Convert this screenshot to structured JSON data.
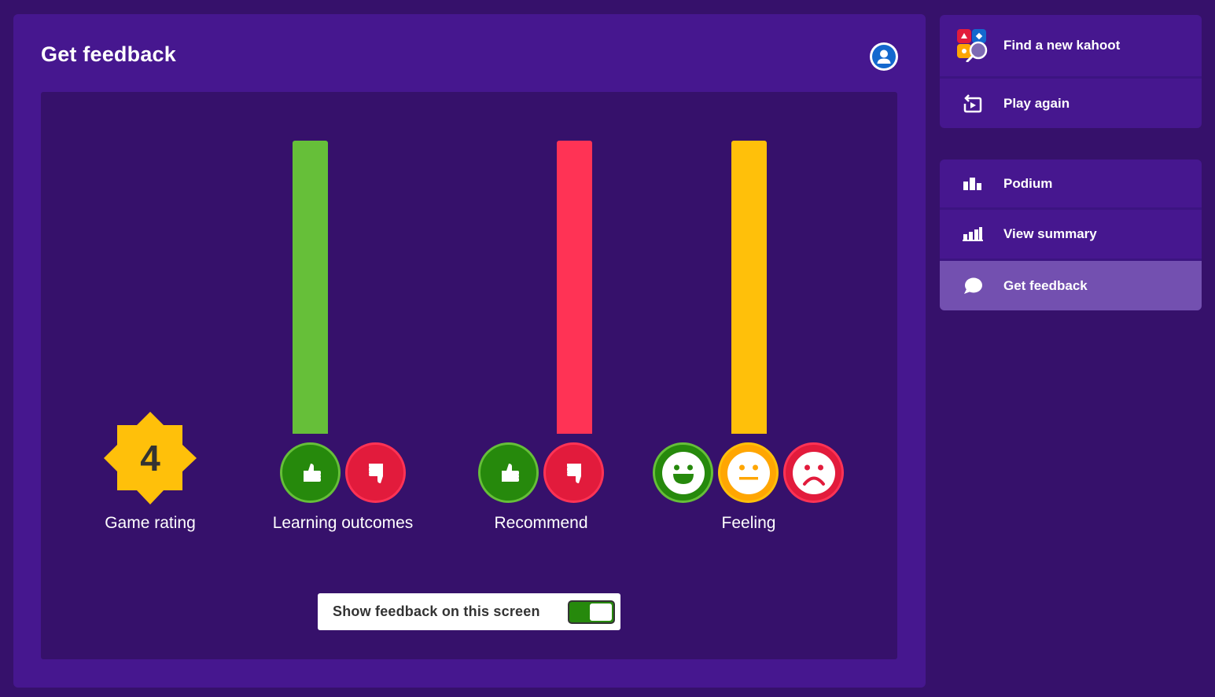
{
  "main": {
    "title": "Get feedback",
    "account_icon": "user-account-icon",
    "rating": {
      "value": "4",
      "label": "Game rating",
      "badge_color": "#ffc00a"
    },
    "groups": [
      {
        "label": "Learning outcomes",
        "bar_color": "#66bf39",
        "bar_fill_fraction": 1.0,
        "options": [
          {
            "icon": "thumbs-up-icon",
            "color": "green"
          },
          {
            "icon": "thumbs-down-icon",
            "color": "red"
          }
        ]
      },
      {
        "label": "Recommend",
        "bar_color": "#ff3355",
        "bar_fill_fraction": 1.0,
        "options": [
          {
            "icon": "thumbs-up-icon",
            "color": "green"
          },
          {
            "icon": "thumbs-down-icon",
            "color": "red"
          }
        ]
      },
      {
        "label": "Feeling",
        "bar_color": "#ffc00a",
        "bar_fill_fraction": 1.0,
        "options": [
          {
            "icon": "happy-face-icon",
            "color": "green"
          },
          {
            "icon": "neutral-face-icon",
            "color": "yellow"
          },
          {
            "icon": "sad-face-icon",
            "color": "red"
          }
        ]
      }
    ],
    "toggle": {
      "label": "Show feedback on this screen",
      "state": "on"
    }
  },
  "sidebar": {
    "top_actions": [
      {
        "label": "Find a new kahoot",
        "icon": "kahoot-search-icon"
      },
      {
        "label": "Play again",
        "icon": "replay-icon"
      }
    ],
    "nav_items": [
      {
        "label": "Podium",
        "icon": "podium-icon",
        "active": false
      },
      {
        "label": "View summary",
        "icon": "bar-chart-icon",
        "active": false
      },
      {
        "label": "Get feedback",
        "icon": "speech-bubble-icon",
        "active": true
      }
    ]
  },
  "colors": {
    "background": "#36116b",
    "panel": "#46178f",
    "active_item": "#7350b0",
    "green": "#26890c",
    "red": "#e21b3c",
    "yellow": "#ffa602"
  }
}
